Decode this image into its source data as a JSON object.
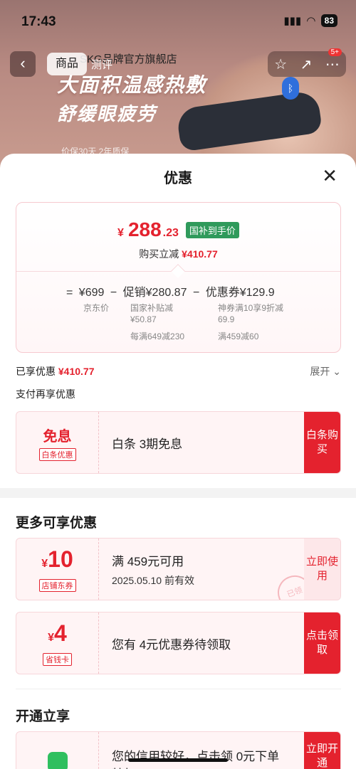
{
  "status": {
    "time": "17:43",
    "battery": "83"
  },
  "nav": {
    "back_icon": "chevron-left-icon",
    "tab_product": "商品",
    "tab_review": "测评",
    "store_name": "SKG品牌官方旗舰店",
    "cart_badge": "5+"
  },
  "banner": {
    "line1": "大面积温感热敷",
    "line2": "舒缓眼疲劳",
    "line3": "价保30天 2年质保"
  },
  "sheet": {
    "title": "优惠",
    "close_icon": "close-icon"
  },
  "price": {
    "currency": "¥",
    "integer": "288",
    "decimal": ".23",
    "tag": "国补到手价",
    "buy_reduce_label": "购买立减",
    "buy_reduce_amount": "¥410.77",
    "f_eq": "=",
    "f_jd": "¥699",
    "f_minus1": "−",
    "f_promo": "促销¥280.87",
    "f_minus2": "−",
    "f_coupon": "优惠券¥129.9",
    "jd_label": "京东价",
    "promo_sub1": "国家补贴减",
    "promo_sub2": "¥50.87",
    "promo_sub3": "每满649减230",
    "coupon_sub1": "神券满10享9折减",
    "coupon_sub2": "69.9",
    "coupon_sub3": "满459减60"
  },
  "enjoyed": {
    "label": "已享优惠",
    "amount": "¥410.77",
    "expand": "展开 ⌄"
  },
  "pay_more": "支付再享优惠",
  "coupons": {
    "interest": {
      "big": "免息",
      "tag": "白条优惠",
      "text": "白条 3期免息",
      "button": "白条购买"
    },
    "more_title": "更多可享优惠",
    "store": {
      "currency": "¥",
      "amount": "10",
      "tag": "店铺东券",
      "line1": "满 459元可用",
      "line2": "2025.05.10 前有效",
      "button": "立即使用",
      "stamp": "已领"
    },
    "saver": {
      "currency": "¥",
      "amount": "4",
      "tag": "省钱卡",
      "text": "您有 4元优惠券待领取",
      "button": "点击领取"
    },
    "open_title": "开通立享",
    "credit": {
      "line1": "您的信用较好，点击领 0元下单",
      "line2": "特权",
      "button": "立即开通"
    }
  }
}
